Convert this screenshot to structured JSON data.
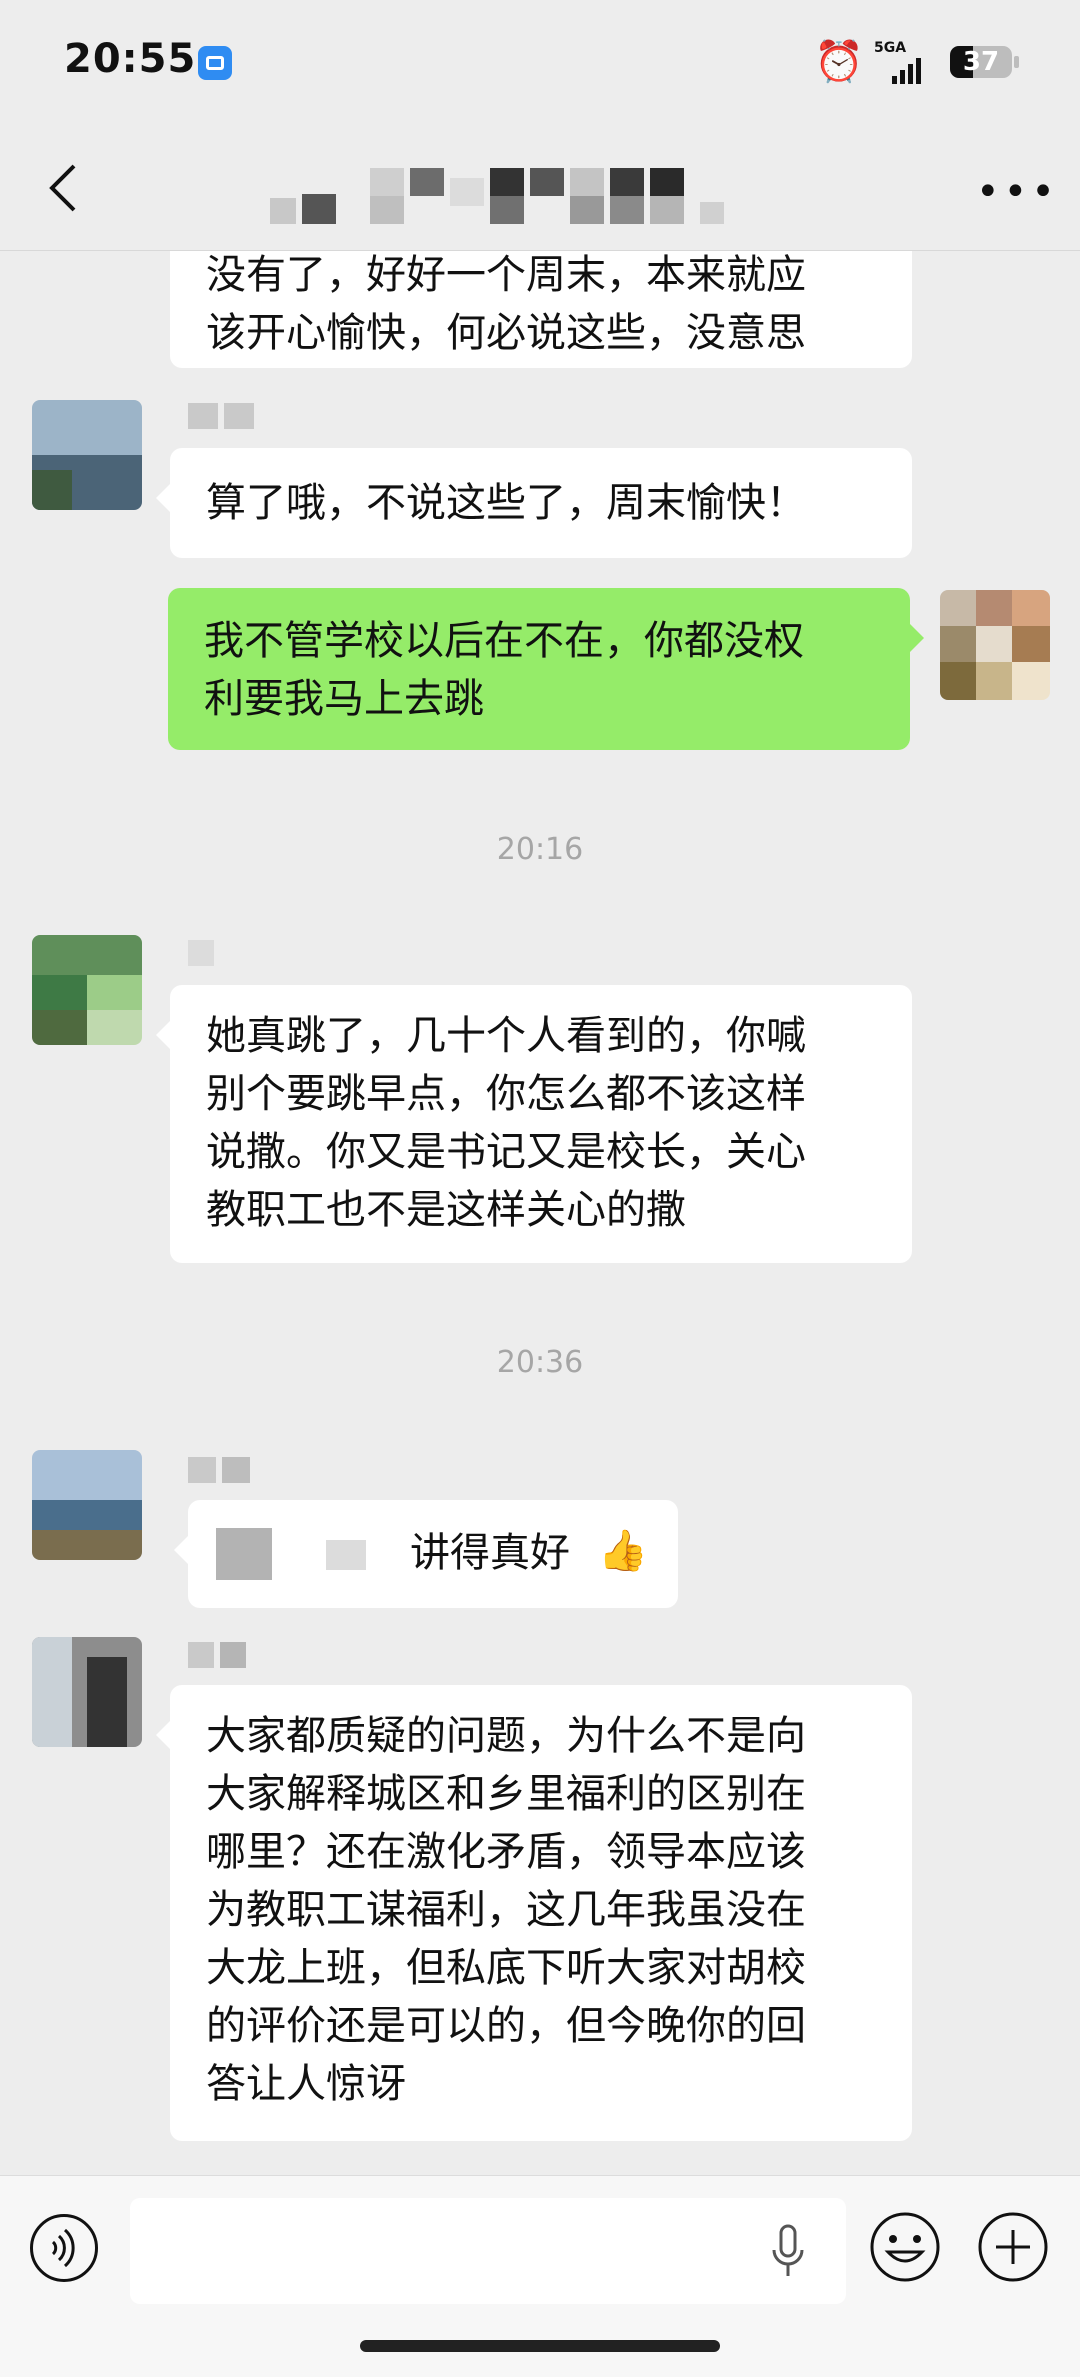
{
  "status_bar": {
    "time": "20:55",
    "network": "5GA",
    "battery": "37",
    "battery_level": 0.37
  },
  "messages": [
    {
      "side": "left",
      "lines": [
        "没有了，好好一个周末，本来就应",
        "该开心愉快，何必说这些，没意思"
      ]
    },
    {
      "side": "left",
      "lines": [
        "算了哦，不说这些了，周末愉快！"
      ]
    },
    {
      "side": "right",
      "lines": [
        "我不管学校以后在不在，你都没权",
        "利要我马上去跳"
      ]
    },
    {
      "side": "center",
      "text": "20:16"
    },
    {
      "side": "left",
      "lines": [
        "她真跳了，几十个人看到的，你喊",
        "别个要跳早点，你怎么都不该这样",
        "说撒。你又是书记又是校长，关心",
        "教职工也不是这样关心的撒"
      ]
    },
    {
      "side": "center",
      "text": "20:36"
    },
    {
      "side": "left",
      "text": "讲得真好",
      "emoji": "👍"
    },
    {
      "side": "left",
      "lines": [
        "大家都质疑的问题，为什么不是向",
        "大家解释城区和乡里福利的区别在",
        "哪里？还在激化矛盾，领导本应该",
        "为教职工谋福利，这几年我虽没在",
        "大龙上班，但私底下听大家对胡校",
        "的评价还是可以的，但今晚你的回",
        "答让人惊讶"
      ]
    }
  ],
  "icons": {
    "back": "back-arrow-icon",
    "more": "more-options-icon",
    "voice": "voice-input-icon",
    "mic": "microphone-icon",
    "emoji": "emoji-icon",
    "plus": "plus-icon"
  }
}
